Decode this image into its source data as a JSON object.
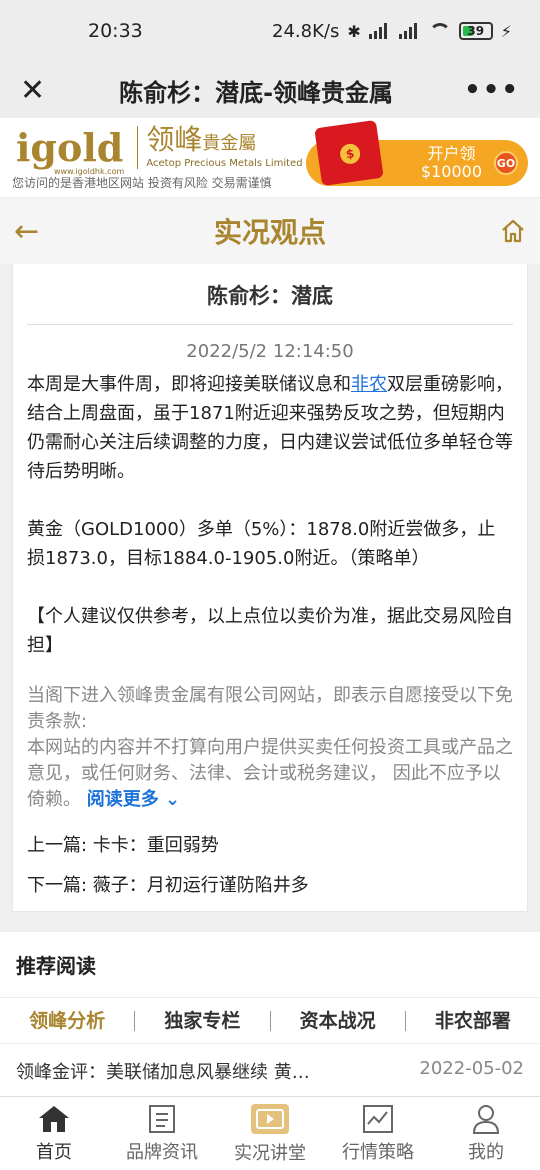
{
  "status": {
    "time": "20:33",
    "speed": "24.8K/s",
    "battery": "39"
  },
  "wechat": {
    "title": "陈俞杉：潜底-领峰贵金属"
  },
  "banner": {
    "logo": "igold",
    "logo_url": "www.igoldhk.com",
    "logo_cn": "领峰",
    "logo_cn_small": "貴金屬",
    "logo_en": "Acetop Precious Metals Limited",
    "notice": "您访问的是香港地区网站 投资有风险 交易需谨慎",
    "promo_line1": "开户领",
    "promo_line2": "$10000",
    "promo_go": "GO"
  },
  "page": {
    "title": "实况观点"
  },
  "article": {
    "title": "陈俞杉：潜底",
    "date": "2022/5/2 12:14:50",
    "para1_pre": "本周是大事件周，即将迎接美联储议息和",
    "para1_link": "非农",
    "para1_post": "双层重磅影响，结合上周盘面，虽于1871附近迎来强势反攻之势，但短期内仍需耐心关注后续调整的力度，日内建议尝试低位多单轻仓等待后势明晰。",
    "para2": "黄金（GOLD1000）多单（5%）：1878.0附近尝做多，止损1873.0，目标1884.0-1905.0附近。（策略单）",
    "para3": "【个人建议仅供参考，以上点位以卖价为准，据此交易风险自担】",
    "disclaimer1": "当阁下进入领峰贵金属有限公司网站，即表示自愿接受以下免责条款:",
    "disclaimer2": "本网站的内容并不打算向用户提供买卖任何投资工具或产品之意见，或任何财务、法律、会计或税务建议， 因此不应予以倚赖。",
    "read_more": "阅读更多",
    "prev": "上一篇: 卡卡：重回弱势",
    "next": "下一篇: 薇子：月初运行谨防陷井多"
  },
  "recommend": {
    "title": "推荐阅读",
    "tabs": [
      "领峰分析",
      "独家专栏",
      "资本战况",
      "非农部署"
    ],
    "items": [
      {
        "title": "领峰金评：美联储加息风暴继续 黄…",
        "date": "2022-05-02"
      }
    ]
  },
  "tabbar": [
    {
      "label": "首页",
      "icon": "home-icon"
    },
    {
      "label": "品牌资讯",
      "icon": "document-icon"
    },
    {
      "label": "实况讲堂",
      "icon": "video-icon"
    },
    {
      "label": "行情策略",
      "icon": "chart-icon"
    },
    {
      "label": "我的",
      "icon": "user-icon"
    }
  ],
  "colors": {
    "accent": "#a9852f",
    "link": "#1e73d9",
    "promo": "#f5a623"
  }
}
